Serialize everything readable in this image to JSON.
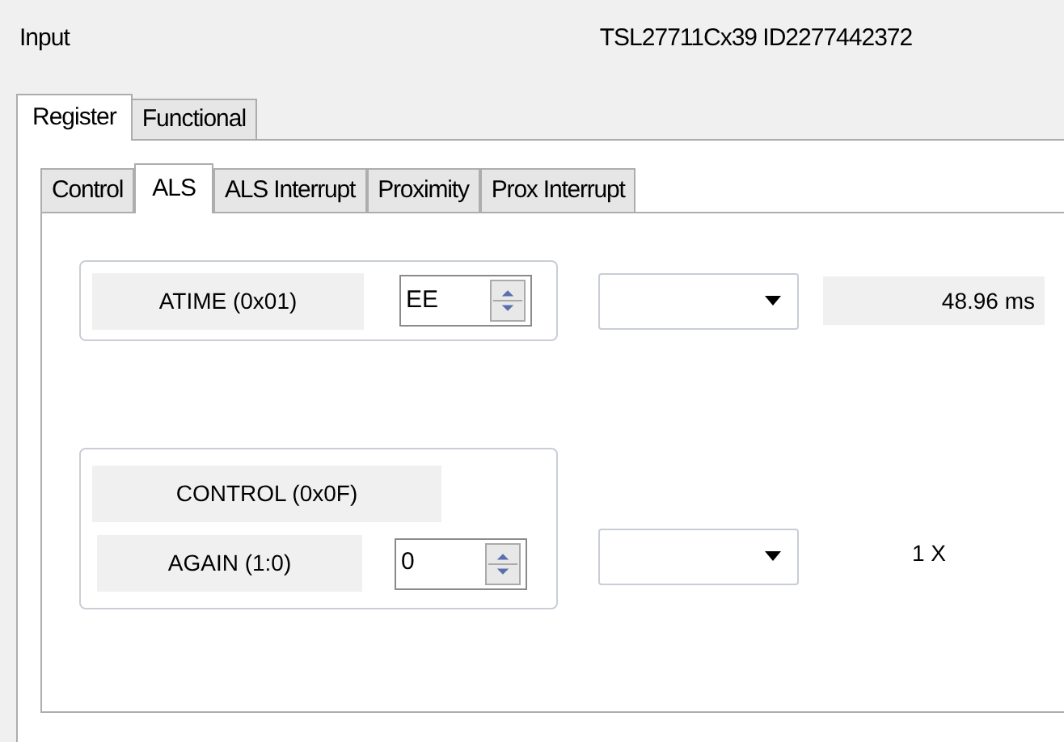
{
  "header": {
    "title": "Input",
    "device": "TSL27711Cx39 ID2277442372"
  },
  "tabs": [
    {
      "label": "Register",
      "selected": true
    },
    {
      "label": "Functional",
      "selected": false
    }
  ],
  "subtabs": [
    {
      "label": "Control",
      "selected": false
    },
    {
      "label": "ALS",
      "selected": true
    },
    {
      "label": "ALS Interrupt",
      "selected": false
    },
    {
      "label": "Proximity",
      "selected": false
    },
    {
      "label": "Prox Interrupt",
      "selected": false
    }
  ],
  "atime": {
    "label": "ATIME (0x01)",
    "value": "EE",
    "reading": "48.96 ms"
  },
  "control": {
    "title": "CONTROL (0x0F)",
    "label": "AGAIN (1:0)",
    "value": "0",
    "reading": "1 X"
  }
}
